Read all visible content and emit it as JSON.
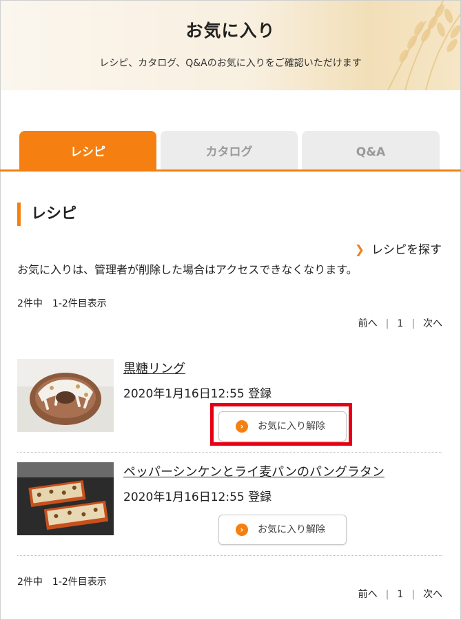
{
  "header": {
    "title": "お気に入り",
    "subtitle": "レシピ、カタログ、Q&Aのお気に入りをご確認いただけます"
  },
  "tabs": [
    {
      "label": "レシピ",
      "active": true
    },
    {
      "label": "カタログ",
      "active": false
    },
    {
      "label": "Q&A",
      "active": false
    }
  ],
  "section": {
    "title": "レシピ",
    "search_link": "レシピを探す",
    "notice": "お気に入りは、管理者が削除した場合はアクセスできなくなります。"
  },
  "pagination": {
    "count_text": "2件中　1-2件目表示",
    "prev": "前へ",
    "page": "1",
    "next": "次へ"
  },
  "items": [
    {
      "title": "黒糖リング",
      "date": "2020年1月16日12:55 登録",
      "button": "お気に入り解除",
      "thumb_icon": "cake-ring-photo"
    },
    {
      "title": "ペッパーシンケンとライ麦パンのパングラタン",
      "date": "2020年1月16日12:55 登録",
      "button": "お気に入り解除",
      "thumb_icon": "bread-gratin-photo"
    }
  ],
  "colors": {
    "accent": "#f58011",
    "highlight": "#e60012",
    "tab_inactive": "#ececec"
  }
}
